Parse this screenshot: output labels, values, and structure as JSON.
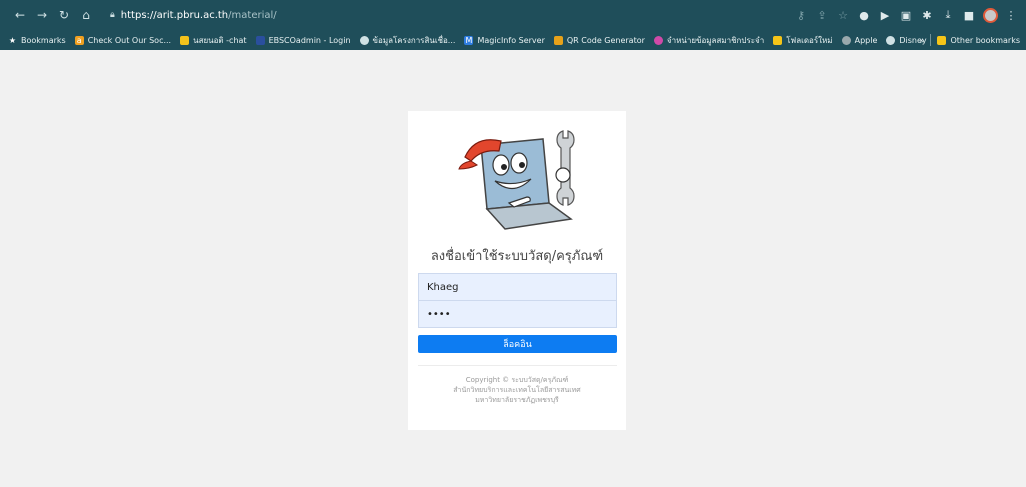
{
  "browser": {
    "url_host": "https://arit.pbru.ac.th",
    "url_path": "/material/",
    "toolbar_colors": {
      "frame": "#1f4e5a"
    }
  },
  "bookmarks": {
    "items": [
      {
        "label": "Bookmarks",
        "icon": "star-icon"
      },
      {
        "label": "Check Out Our Soc...",
        "icon": "amazon-icon"
      },
      {
        "label": "นสยนอติ -chat",
        "icon": "chat-icon"
      },
      {
        "label": "EBSCOadmin - Login",
        "icon": "ebsco-icon"
      },
      {
        "label": "ข้อมูลโครงการสินเชื่อ...",
        "icon": "globe-icon"
      },
      {
        "label": "MagicInfo Server",
        "icon": "magicinfo-icon"
      },
      {
        "label": "QR Code Generator",
        "icon": "qr-icon"
      },
      {
        "label": "จำหน่ายข้อมูลสมาชิกประจำ",
        "icon": "app-icon"
      },
      {
        "label": "โฟลเดอร์ใหม่",
        "icon": "folder-icon"
      },
      {
        "label": "Apple",
        "icon": "apple-icon"
      },
      {
        "label": "Disney",
        "icon": "globe-icon"
      }
    ],
    "overflow": "»",
    "other": "Other bookmarks"
  },
  "login": {
    "title": "ลงชื่อเข้าใช้ระบบวัสดุ/ครุภัณฑ์",
    "username_value": "Khaeg",
    "password_value": "••••",
    "button_label": "ล็อคอิน",
    "footer_line1": "Copyright © ระบบวัสดุ/ครุภัณฑ์",
    "footer_line2": "สำนักวิทยบริการและเทคโนโลยีสารสนเทศ",
    "footer_line3": "มหาวิทยาลัยราชภัฏเพชรบุรี",
    "accent": "#0d7cf2"
  }
}
